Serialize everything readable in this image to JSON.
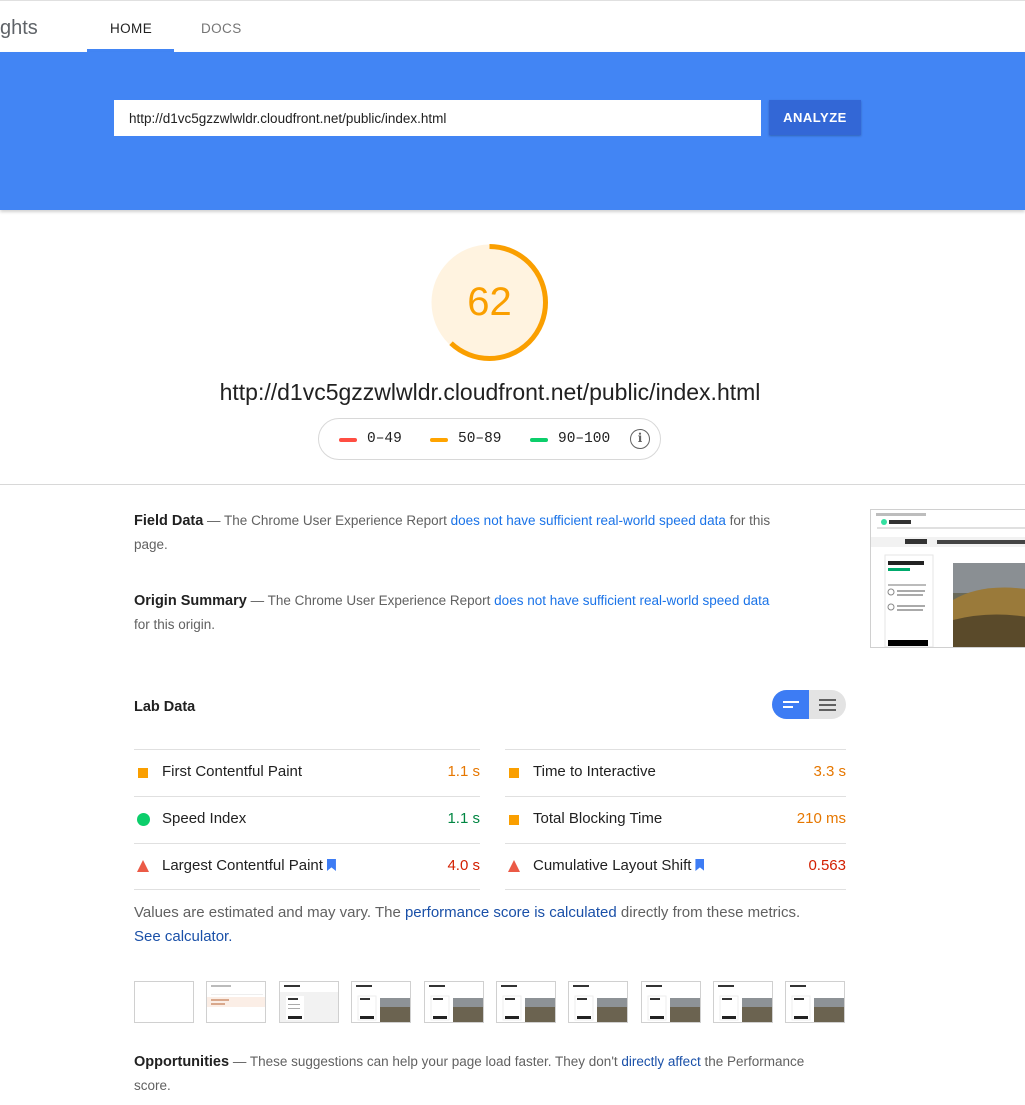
{
  "header": {
    "brand": "ghts",
    "tabs": [
      {
        "label": "HOME"
      },
      {
        "label": "DOCS"
      }
    ]
  },
  "hero": {
    "url_value": "http://d1vc5gzzwlwldr.cloudfront.net/public/index.html",
    "analyze_label": "ANALYZE"
  },
  "score": {
    "value": "62",
    "fraction": 0.62,
    "color": "#fa9f00",
    "url": "http://d1vc5gzzwlwldr.cloudfront.net/public/index.html"
  },
  "legend": [
    {
      "label": "0–49",
      "color": "#ff4e42"
    },
    {
      "label": "50–89",
      "color": "#ffa400"
    },
    {
      "label": "90–100",
      "color": "#0cce6b"
    }
  ],
  "field_data": {
    "title": "Field Data",
    "pre": " — The Chrome User Experience Report ",
    "link": "does not have sufficient real-world speed data",
    "post": " for this page."
  },
  "origin_summary": {
    "title": "Origin Summary",
    "pre": " — The Chrome User Experience Report ",
    "link": "does not have sufficient real-world speed data",
    "post": " for this origin."
  },
  "lab": {
    "title": "Lab Data",
    "metrics": [
      {
        "label": "First Contentful Paint",
        "value": "1.1 s"
      },
      {
        "label": "Time to Interactive",
        "value": "3.3 s"
      },
      {
        "label": "Speed Index",
        "value": "1.1 s"
      },
      {
        "label": "Total Blocking Time",
        "value": "210 ms"
      },
      {
        "label": "Largest Contentful Paint",
        "value": "4.0 s"
      },
      {
        "label": "Cumulative Layout Shift",
        "value": "0.563"
      }
    ]
  },
  "estimate": {
    "pre": "Values are estimated and may vary. The ",
    "link1": "performance score is calculated",
    "mid": " directly from these metrics. ",
    "link2": "See calculator."
  },
  "opportunities": {
    "title": "Opportunities",
    "pre": " — These suggestions can help your page load faster. They don't ",
    "link": "directly affect",
    "post": " the Performance score."
  },
  "thumbnail": {
    "headline": "Panoramic Beach",
    "banner": "Save money. We cover 200+ sites for the lowest hotel"
  }
}
